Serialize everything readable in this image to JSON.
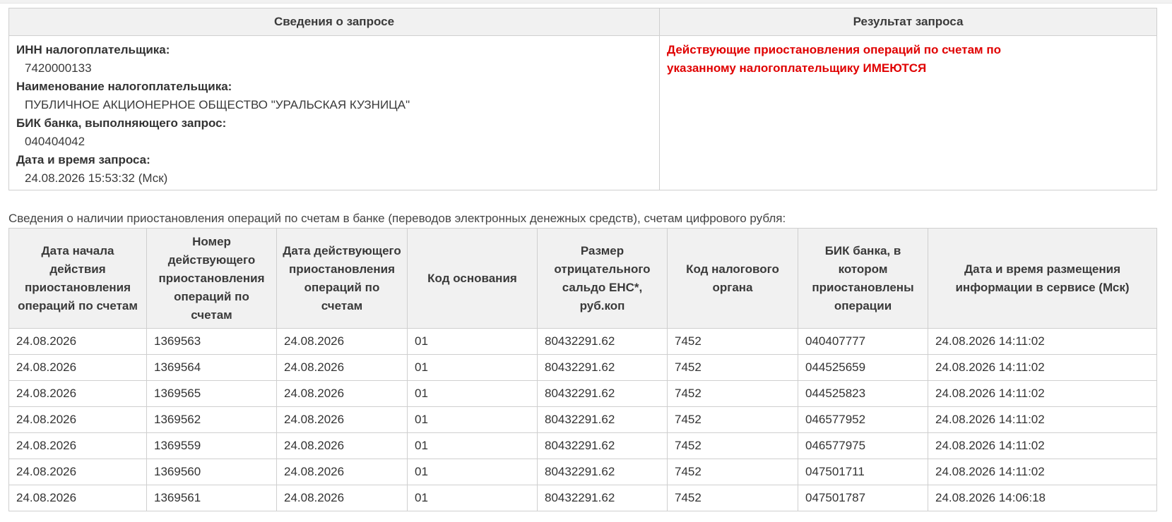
{
  "colors": {
    "result_accent": "#e00000"
  },
  "request_table": {
    "header_info": "Сведения о запросе",
    "header_result": "Результат запроса",
    "fields": [
      {
        "label": "ИНН налогоплательщика:",
        "value": "7420000133"
      },
      {
        "label": "Наименование налогоплательщика:",
        "value": "ПУБЛИЧНОЕ АКЦИОНЕРНОЕ ОБЩЕСТВО \"УРАЛЬСКАЯ КУЗНИЦА\""
      },
      {
        "label": "БИК банка, выполняющего запрос:",
        "value": "040404042"
      },
      {
        "label": "Дата и время запроса:",
        "value": "24.08.2026 15:53:32 (Мск)"
      }
    ],
    "result_line1": "Действующие приостановления операций по счетам по",
    "result_line2": "указанному налогоплательщику ИМЕЮТСЯ"
  },
  "caption": "Сведения о наличии приостановления операций по счетам в банке (переводов электронных денежных средств), счетам цифрового рубля:",
  "suspensions": {
    "columns": [
      "Дата начала действия приостановления операций по счетам",
      "Номер действующего приостановления операций по счетам",
      "Дата действующего приостановления операций по счетам",
      "Код основания",
      "Размер отрицательного сальдо ЕНС*, руб.коп",
      "Код налогового органа",
      "БИК банка, в котором приостановлены операции",
      "Дата и время размещения информации в сервисе (Мск)"
    ],
    "rows": [
      [
        "24.08.2026",
        "1369563",
        "24.08.2026",
        "01",
        "80432291.62",
        "7452",
        "040407777",
        "24.08.2026 14:11:02"
      ],
      [
        "24.08.2026",
        "1369564",
        "24.08.2026",
        "01",
        "80432291.62",
        "7452",
        "044525659",
        "24.08.2026 14:11:02"
      ],
      [
        "24.08.2026",
        "1369565",
        "24.08.2026",
        "01",
        "80432291.62",
        "7452",
        "044525823",
        "24.08.2026 14:11:02"
      ],
      [
        "24.08.2026",
        "1369562",
        "24.08.2026",
        "01",
        "80432291.62",
        "7452",
        "046577952",
        "24.08.2026 14:11:02"
      ],
      [
        "24.08.2026",
        "1369559",
        "24.08.2026",
        "01",
        "80432291.62",
        "7452",
        "046577975",
        "24.08.2026 14:11:02"
      ],
      [
        "24.08.2026",
        "1369560",
        "24.08.2026",
        "01",
        "80432291.62",
        "7452",
        "047501711",
        "24.08.2026 14:11:02"
      ],
      [
        "24.08.2026",
        "1369561",
        "24.08.2026",
        "01",
        "80432291.62",
        "7452",
        "047501787",
        "24.08.2026 14:06:18"
      ]
    ]
  }
}
